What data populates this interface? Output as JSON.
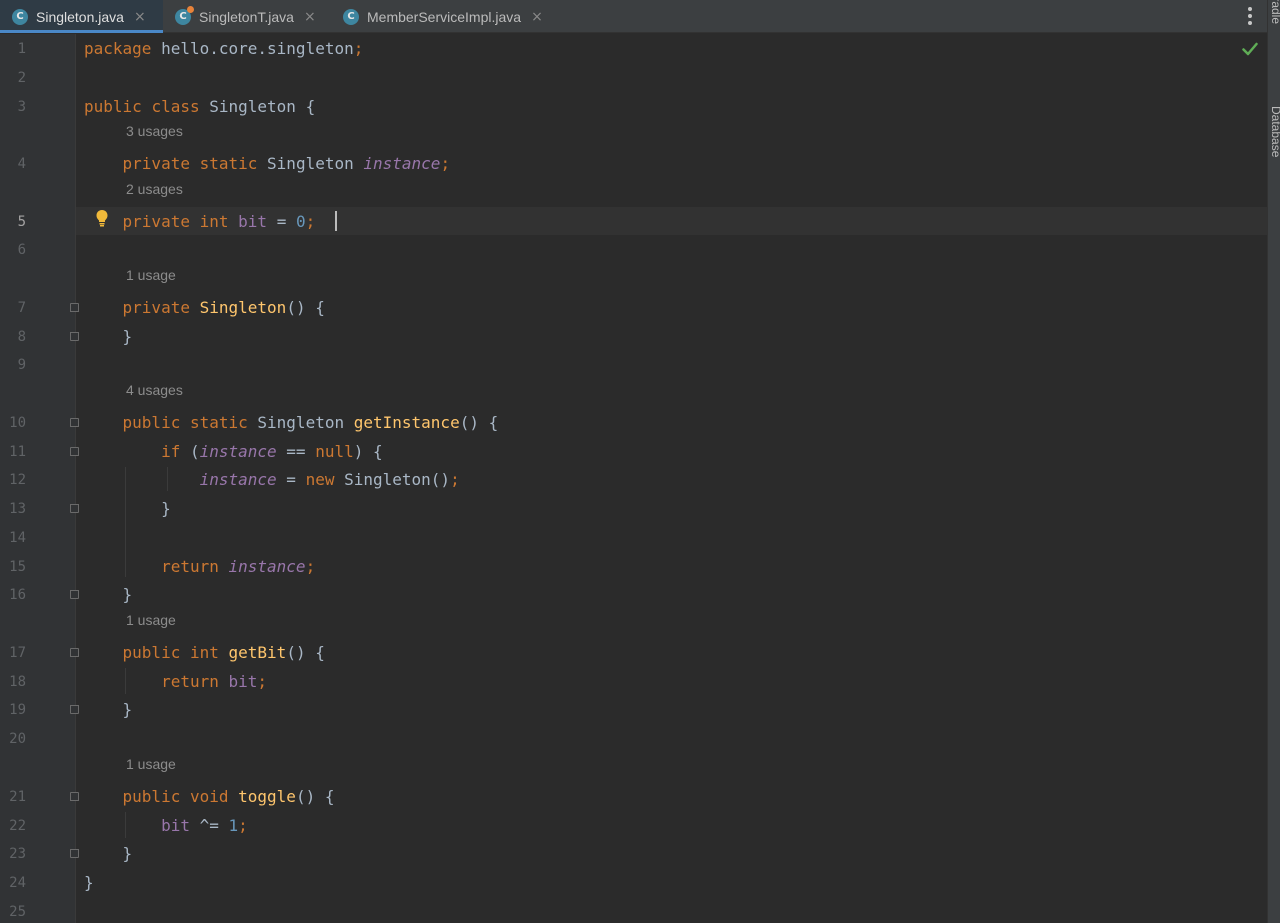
{
  "tabs": [
    {
      "name": "Singleton.java",
      "icon": "class-icon",
      "active": true
    },
    {
      "name": "SingletonT.java",
      "icon": "runnable-class-icon",
      "active": false
    },
    {
      "name": "MemberServiceImpl.java",
      "icon": "class-icon",
      "active": false
    }
  ],
  "tab_icon_letter": "C",
  "tab_close_glyph": "×",
  "right_tools": [
    "Gradle",
    "Database"
  ],
  "editor": {
    "current_line": "5",
    "lines": [
      {
        "n": "1",
        "code": "package hello.core.singleton;"
      },
      {
        "n": "2",
        "code": ""
      },
      {
        "n": "3",
        "code": "public class Singleton {"
      },
      {
        "n": "4",
        "code": "    private static Singleton instance;",
        "hint": "3 usages"
      },
      {
        "n": "5",
        "code": "    private int bit = 0;",
        "hint": "2 usages"
      },
      {
        "n": "6",
        "code": ""
      },
      {
        "n": "7",
        "code": "    private Singleton() {",
        "hint": "1 usage"
      },
      {
        "n": "8",
        "code": "    }"
      },
      {
        "n": "9",
        "code": ""
      },
      {
        "n": "10",
        "code": "    public static Singleton getInstance() {",
        "hint": "4 usages"
      },
      {
        "n": "11",
        "code": "        if (instance == null) {"
      },
      {
        "n": "12",
        "code": "            instance = new Singleton();"
      },
      {
        "n": "13",
        "code": "        }"
      },
      {
        "n": "14",
        "code": ""
      },
      {
        "n": "15",
        "code": "        return instance;"
      },
      {
        "n": "16",
        "code": "    }"
      },
      {
        "n": "17",
        "code": "    public int getBit() {",
        "hint": "1 usage"
      },
      {
        "n": "18",
        "code": "        return bit;"
      },
      {
        "n": "19",
        "code": "    }"
      },
      {
        "n": "20",
        "code": ""
      },
      {
        "n": "21",
        "code": "    public void toggle() {",
        "hint": "1 usage"
      },
      {
        "n": "22",
        "code": "        bit ^= 1;"
      },
      {
        "n": "23",
        "code": "    }"
      },
      {
        "n": "24",
        "code": "}"
      },
      {
        "n": "25",
        "code": ""
      }
    ]
  },
  "colors": {
    "keyword": "#cc7832",
    "method": "#ffc66d",
    "field": "#9876aa",
    "number": "#6897bb",
    "text": "#a9b7c6",
    "hint": "#8c8c8c",
    "accent": "#4a88c7",
    "check": "#5fad56",
    "bulb": "#f0b93a"
  },
  "status_icon": "check-icon"
}
